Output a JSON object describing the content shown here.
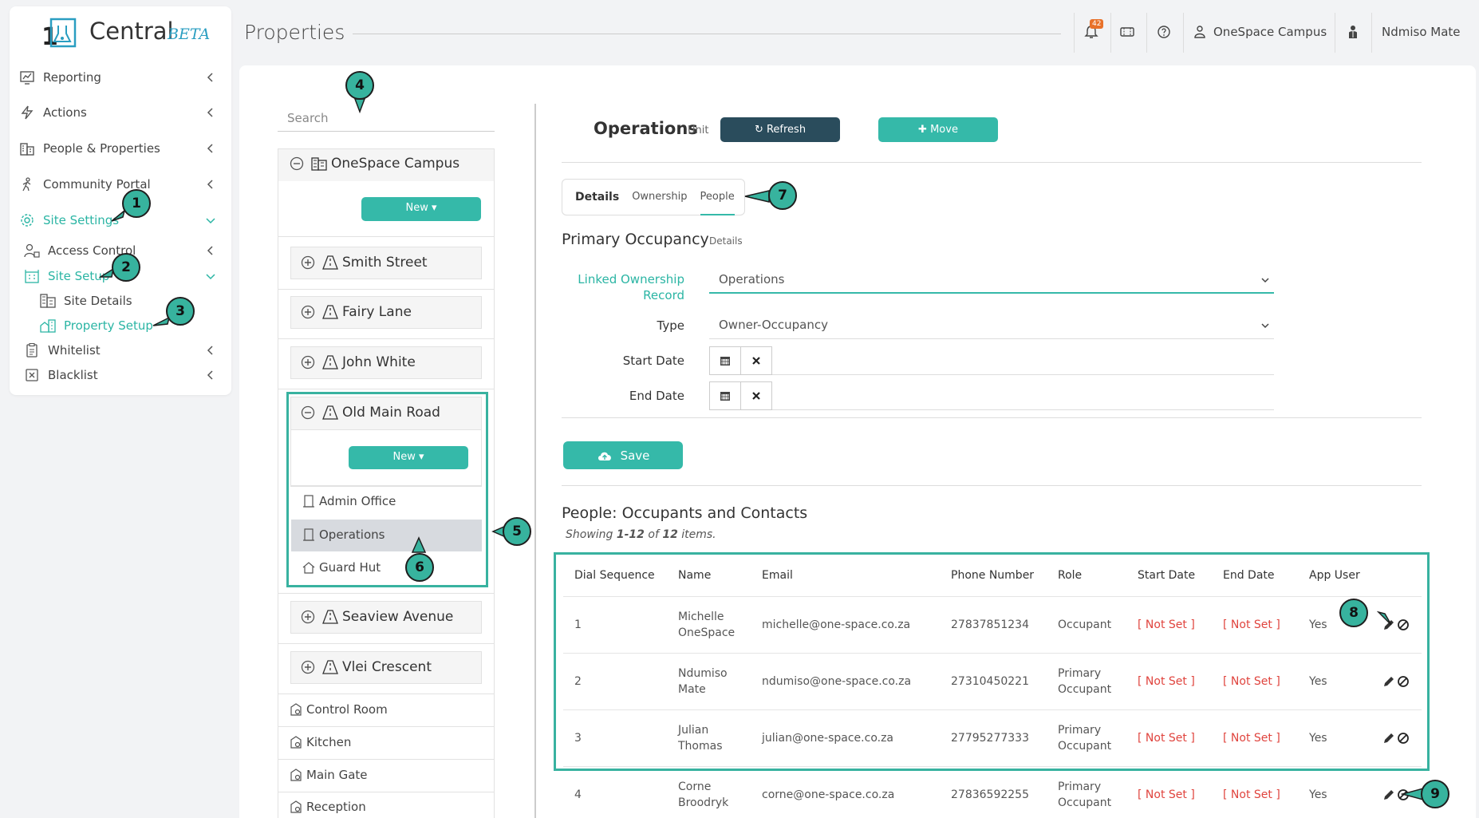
{
  "app": {
    "logo_number": "1",
    "name": "Central",
    "beta": "BETA"
  },
  "sidebar": {
    "items": [
      {
        "label": "Reporting"
      },
      {
        "label": "Actions"
      },
      {
        "label": "People & Properties"
      },
      {
        "label": "Community Portal"
      },
      {
        "label": "Site Settings"
      },
      {
        "label": "Access Control"
      },
      {
        "label": "Site Setup"
      },
      {
        "label": "Site Details"
      },
      {
        "label": "Property Setup"
      },
      {
        "label": "Whitelist"
      },
      {
        "label": "Blacklist"
      }
    ]
  },
  "header": {
    "title": "Properties",
    "notif_count": "42",
    "campus": "OneSpace Campus",
    "user": "Ndmiso Mate"
  },
  "tree": {
    "search_placeholder": "Search",
    "root": "OneSpace Campus",
    "new_label": "New",
    "nodes": [
      "Smith Street",
      "Fairy Lane",
      "John White",
      "Old Main Road",
      "Seaview Avenue",
      "Vlei Crescent"
    ],
    "children": [
      "Admin Office",
      "Operations",
      "Guard Hut"
    ],
    "leaves": [
      "Control Room",
      "Kitchen",
      "Main Gate",
      "Reception"
    ]
  },
  "detail": {
    "title": "Operations",
    "unit": "Unit",
    "refresh": "Refresh",
    "move": "Move",
    "tabs": [
      "Details",
      "Ownership",
      "People"
    ],
    "section_title": "Primary Occupancy",
    "section_sub": "Details",
    "form": {
      "linked_label_1": "Linked Ownership",
      "linked_label_2": "Record",
      "linked_value": "Operations",
      "type_label": "Type",
      "type_value": "Owner-Occupancy",
      "start_label": "Start Date",
      "end_label": "End Date"
    },
    "save": "Save",
    "people_title": "People: Occupants and Contacts",
    "showing_prefix": "Showing ",
    "showing_range": "1-12",
    "showing_of": " of ",
    "showing_total": "12",
    "showing_suffix": " items."
  },
  "table": {
    "headers": [
      "Dial Sequence",
      "Name",
      "Email",
      "Phone Number",
      "Role",
      "Start Date",
      "End Date",
      "App User"
    ],
    "rows": [
      {
        "seq": "1",
        "name1": "Michelle",
        "name2": "OneSpace",
        "email": "michelle@one-space.co.za",
        "phone": "27837851234",
        "role1": "Occupant",
        "role2": "",
        "start": "[ Not Set ]",
        "end": "[ Not Set ]",
        "app": "Yes"
      },
      {
        "seq": "2",
        "name1": "Ndumiso",
        "name2": "Mate",
        "email": "ndumiso@one-space.co.za",
        "phone": "27310450221",
        "role1": "Primary",
        "role2": "Occupant",
        "start": "[ Not Set ]",
        "end": "[ Not Set ]",
        "app": "Yes"
      },
      {
        "seq": "3",
        "name1": "Julian",
        "name2": "Thomas",
        "email": "julian@one-space.co.za",
        "phone": "27795277333",
        "role1": "Primary",
        "role2": "Occupant",
        "start": "[ Not Set ]",
        "end": "[ Not Set ]",
        "app": "Yes"
      },
      {
        "seq": "4",
        "name1": "Corne",
        "name2": "Broodryk",
        "email": "corne@one-space.co.za",
        "phone": "27836592255",
        "role1": "Primary",
        "role2": "Occupant",
        "start": "[ Not Set ]",
        "end": "[ Not Set ]",
        "app": "Yes"
      }
    ]
  },
  "callouts": [
    "1",
    "2",
    "3",
    "4",
    "5",
    "6",
    "7",
    "8",
    "9"
  ],
  "colors": {
    "accent": "#35b9a9",
    "dark_button": "#2a4c5c",
    "not_set": "#e0443e",
    "badge": "#e8712a"
  }
}
